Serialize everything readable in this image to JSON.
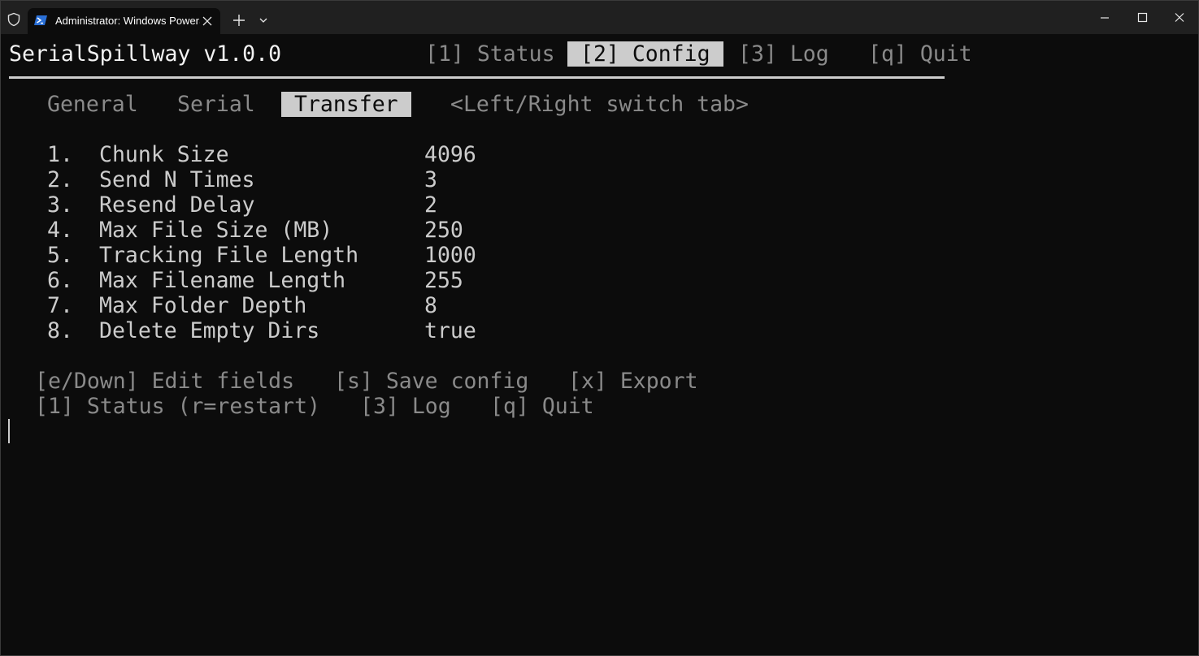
{
  "titlebar": {
    "tab_title": "Administrator: Windows PowerShell",
    "icons": {
      "shield": "shield-icon",
      "tab": "powershell-icon",
      "close": "close-icon",
      "new_tab": "plus-icon",
      "dropdown": "chevron-down-icon",
      "minimize": "minimize-icon",
      "maximize": "maximize-icon",
      "window_close": "close-icon"
    }
  },
  "app": {
    "title": "SerialSpillway v1.0.0",
    "nav": [
      {
        "label": "[1] Status",
        "active": false
      },
      {
        "label": "[2] Config",
        "active": true
      },
      {
        "label": "[3] Log",
        "active": false
      },
      {
        "label": "[q] Quit",
        "active": false
      }
    ]
  },
  "subtabs": {
    "items": [
      {
        "label": "General",
        "active": false
      },
      {
        "label": "Serial",
        "active": false
      },
      {
        "label": "Transfer",
        "active": true
      }
    ],
    "hint": "<Left/Right switch tab>"
  },
  "fields": [
    {
      "num": "1.",
      "label": "Chunk Size",
      "value": "4096"
    },
    {
      "num": "2.",
      "label": "Send N Times",
      "value": "3"
    },
    {
      "num": "3.",
      "label": "Resend Delay",
      "value": "2"
    },
    {
      "num": "4.",
      "label": "Max File Size (MB)",
      "value": "250"
    },
    {
      "num": "5.",
      "label": "Tracking File Length",
      "value": "1000"
    },
    {
      "num": "6.",
      "label": "Max Filename Length",
      "value": "255"
    },
    {
      "num": "7.",
      "label": "Max Folder Depth",
      "value": "8"
    },
    {
      "num": "8.",
      "label": "Delete Empty Dirs",
      "value": "true"
    }
  ],
  "help": {
    "line1": [
      "[e/Down] Edit fields",
      "[s] Save config",
      "[x] Export"
    ],
    "line2": [
      "[1] Status (r=restart)",
      "[3] Log",
      "[q] Quit"
    ]
  },
  "colors": {
    "background": "#0c0c0c",
    "foreground": "#cccccc",
    "dim": "#8a8a8a",
    "titlebar": "#202020"
  }
}
